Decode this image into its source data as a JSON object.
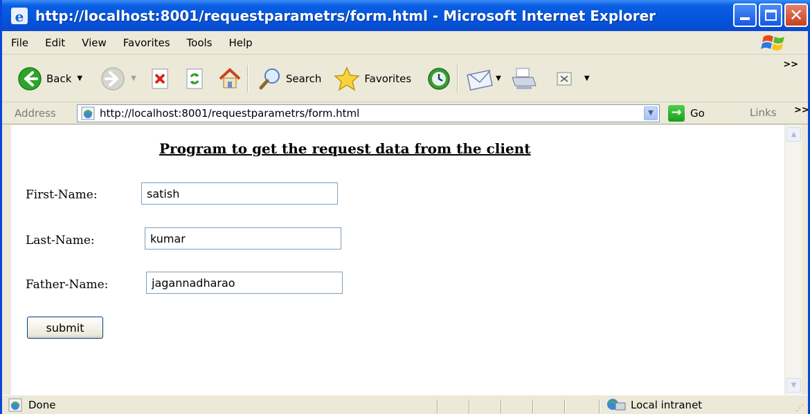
{
  "window": {
    "title": "http://localhost:8001/requestparametrs/form.html - Microsoft Internet Explorer"
  },
  "menu": {
    "items": [
      "File",
      "Edit",
      "View",
      "Favorites",
      "Tools",
      "Help"
    ]
  },
  "toolbar": {
    "back_label": "Back",
    "search_label": "Search",
    "favorites_label": "Favorites",
    "overflow": ">>"
  },
  "address": {
    "label": "Address",
    "url": "http://localhost:8001/requestparametrs/form.html",
    "go_label": "Go",
    "links_label": "Links",
    "links_overflow": ">>"
  },
  "page": {
    "heading": "Program to get the request data from the client",
    "fields": [
      {
        "label": "First-Name:",
        "value": "satish"
      },
      {
        "label": "Last-Name:",
        "value": "kumar"
      },
      {
        "label": "Father-Name:",
        "value": "jagannadharao"
      }
    ],
    "submit_label": "submit"
  },
  "status": {
    "text": "Done",
    "zone": "Local intranet"
  },
  "colors": {
    "titlebar": "#0356dc",
    "chrome": "#ece9d8",
    "input_border": "#7f9db9"
  }
}
